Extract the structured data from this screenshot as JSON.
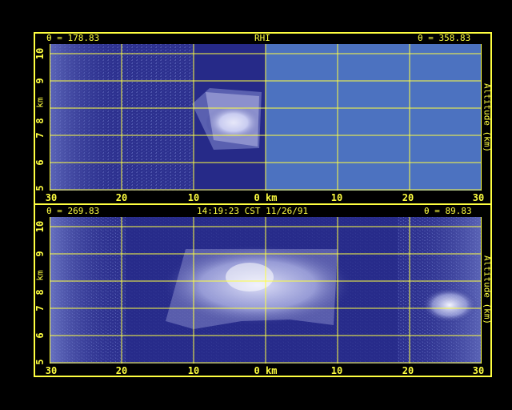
{
  "colors": {
    "frame": "#ffff40",
    "grid": "#ffff40",
    "background": "#000000",
    "scan_blue": "#2a2e8c",
    "no_data_blue": "#4c72c0",
    "echo": "#e6e8ff"
  },
  "top_panel": {
    "left_angle": "θ = 178.83",
    "title": "RHI",
    "right_angle": "θ = 358.83",
    "y_label": "km",
    "right_label": "Altitude (km)",
    "y_ticks": [
      "5",
      "6",
      "7",
      "8",
      "9",
      "10"
    ],
    "x_ticks": [
      "30",
      "20",
      "10",
      "0 km",
      "10",
      "20",
      "30"
    ]
  },
  "bottom_panel": {
    "left_angle": "θ = 269.83",
    "timestamp": "14:19:23 CST 11/26/91",
    "right_angle": "θ = 89.83",
    "y_label": "km",
    "right_label": "Altitude (km)",
    "y_ticks": [
      "5",
      "6",
      "7",
      "8",
      "9",
      "10"
    ],
    "x_ticks": [
      "30",
      "20",
      "10",
      "0 km",
      "10",
      "20",
      "30"
    ]
  }
}
